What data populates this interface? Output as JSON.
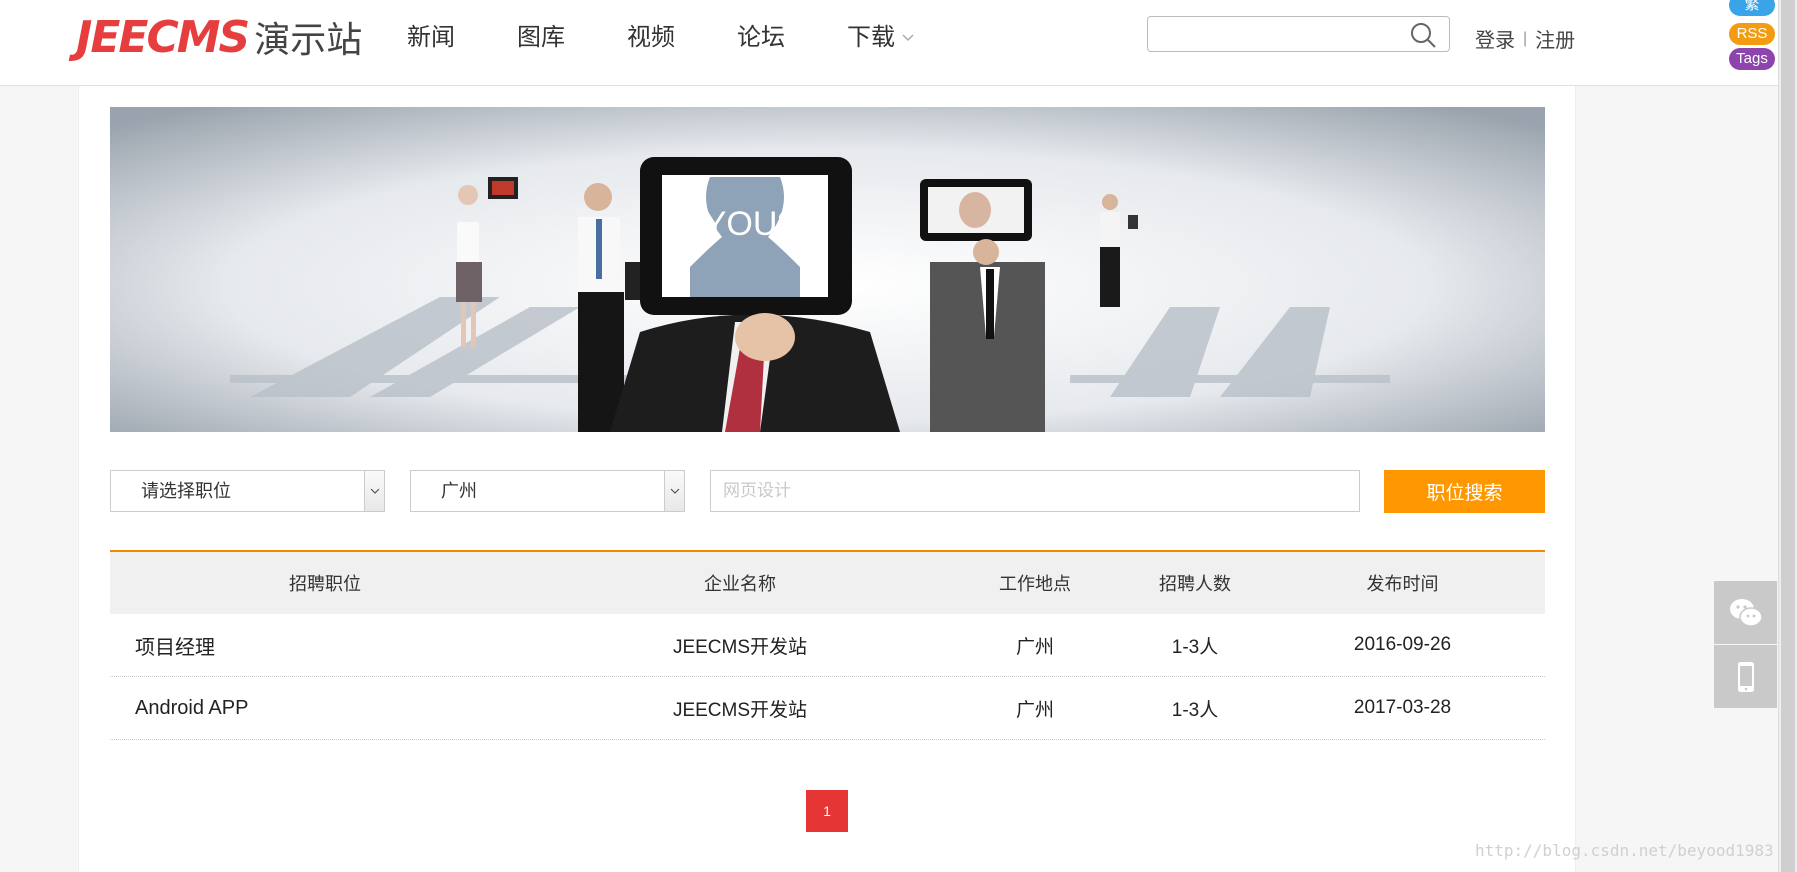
{
  "header": {
    "logo_brand": "JEECMS",
    "logo_sub": "演示站",
    "nav": [
      "新闻",
      "图库",
      "视频",
      "论坛",
      "下载"
    ],
    "search_placeholder": "",
    "login": "登录",
    "separator": "|",
    "register": "注册",
    "badges": [
      "繁",
      "RSS",
      "Tags"
    ]
  },
  "banner": {
    "caption": "YOU?"
  },
  "filters": {
    "position_select": "请选择职位",
    "city_select": "广州",
    "keyword_placeholder": "网页设计",
    "search_button": "职位搜索"
  },
  "table": {
    "headers": [
      "招聘职位",
      "企业名称",
      "工作地点",
      "招聘人数",
      "发布时间"
    ],
    "rows": [
      [
        "项目经理",
        "JEECMS开发站",
        "广州",
        "1-3人",
        "2016-09-26"
      ],
      [
        "Android APP",
        "JEECMS开发站",
        "广州",
        "1-3人",
        "2017-03-28"
      ]
    ]
  },
  "pagination": {
    "current": "1"
  },
  "watermark": "http://blog.csdn.net/beyood1983",
  "colors": {
    "accent": "#ff9800",
    "logo": "#e63e3e",
    "link": "#1a73c9",
    "pager": "#e63535"
  }
}
